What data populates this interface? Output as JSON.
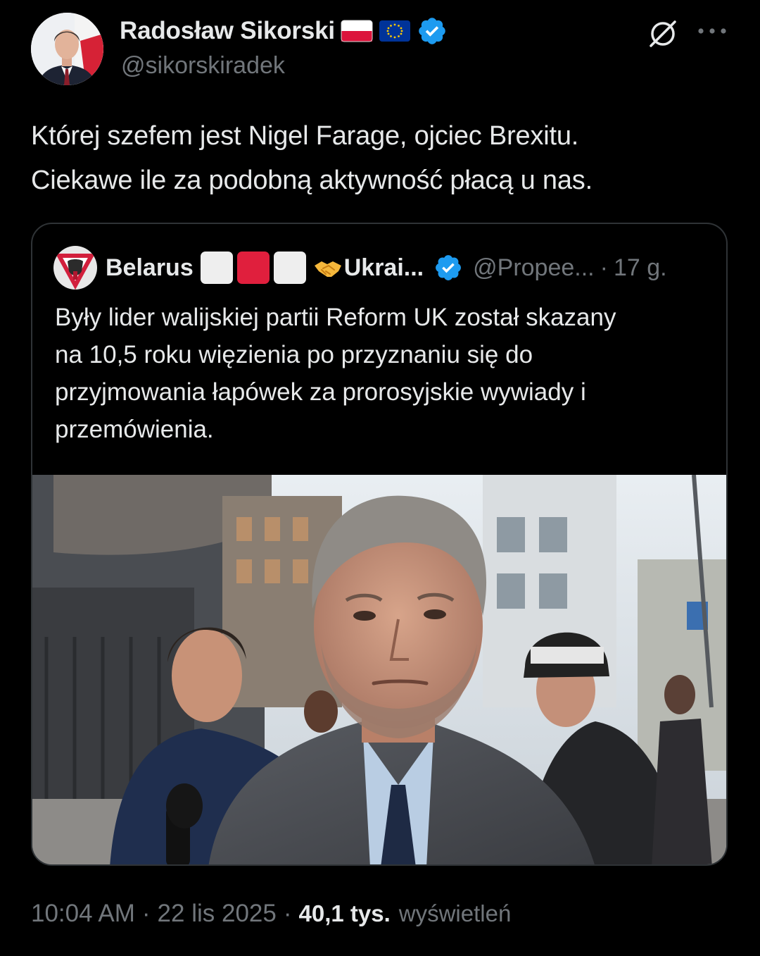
{
  "tweet": {
    "author_name": "Radosław Sikorski",
    "author_handle": "@sikorskiradek",
    "author_flags": [
      "poland-flag",
      "eu-flag"
    ],
    "verified_icon": "verified-badge-icon",
    "grok_icon": "grok-icon",
    "more_icon": "more-icon",
    "text": "Której szefem jest Nigel Farage, ojciec Brexitu.\nCiekawe ile za podobną aktywność płacą u nas.",
    "time": "10:04 AM",
    "date": "22 lis 2025",
    "views_count": "40,1 tys.",
    "views_label": "wyświetleń",
    "separator": "·"
  },
  "quote": {
    "author_name": "Belarus",
    "name_suffix": "Ukrai...",
    "emoji_sequence": [
      "white-square",
      "red-square",
      "white-square",
      "handshake-icon"
    ],
    "handle": "@Propee...",
    "separator": "·",
    "time": "17 g.",
    "text": "Były lider walijskiej partii Reform UK został skazany\nna 10,5 roku więzienia po przyznaniu się do\nprzyjmowania łapówek za prorosyjskie wywiady i\nprzemówienia.",
    "media": "photo of man in grey coat walking outside courthouse, reporters behind"
  },
  "colors": {
    "background": "#000000",
    "text_primary": "#e7e9ea",
    "text_secondary": "#71767b",
    "border": "#2f3336",
    "verified_blue": "#1d9bf0",
    "belarus_red": "#e01f3d"
  }
}
